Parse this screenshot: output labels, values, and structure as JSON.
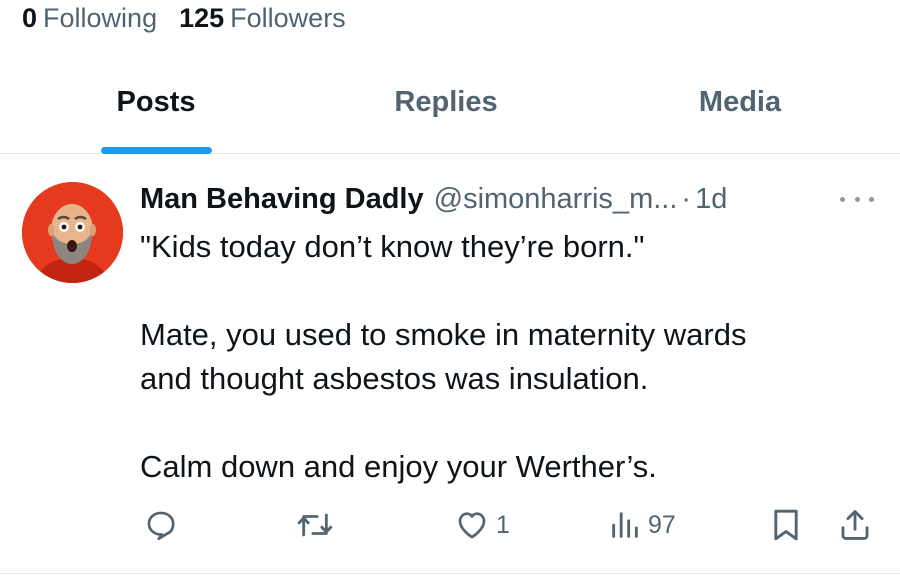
{
  "profile": {
    "following_count": "0",
    "following_label": "Following",
    "followers_count": "125",
    "followers_label": "Followers"
  },
  "tabs": [
    {
      "label": "Posts",
      "active": true
    },
    {
      "label": "Replies",
      "active": false
    },
    {
      "label": "Media",
      "active": false
    }
  ],
  "colors": {
    "accent": "#1d9bf0",
    "text_primary": "#0f1419",
    "text_secondary": "#536471",
    "avatar_bg": "#e63a1e"
  },
  "post": {
    "display_name": "Man Behaving Dadly",
    "handle": "@simonharris_m...",
    "separator": "·",
    "time": "1d",
    "lines": [
      "\"Kids today don’t know they’re born.\"",
      "",
      "Mate, you used to smoke in maternity wards",
      "and thought asbestos was insulation.",
      "",
      "Calm down and enjoy your Werther’s."
    ],
    "actions": {
      "reply_icon": "speech-bubble-icon",
      "repost_icon": "repost-arrows-icon",
      "like_icon": "heart-icon",
      "like_count": "1",
      "views_icon": "bar-chart-icon",
      "views_count": "97",
      "bookmark_icon": "bookmark-icon",
      "share_icon": "share-upload-icon",
      "more_icon": "ellipsis-icon"
    }
  }
}
